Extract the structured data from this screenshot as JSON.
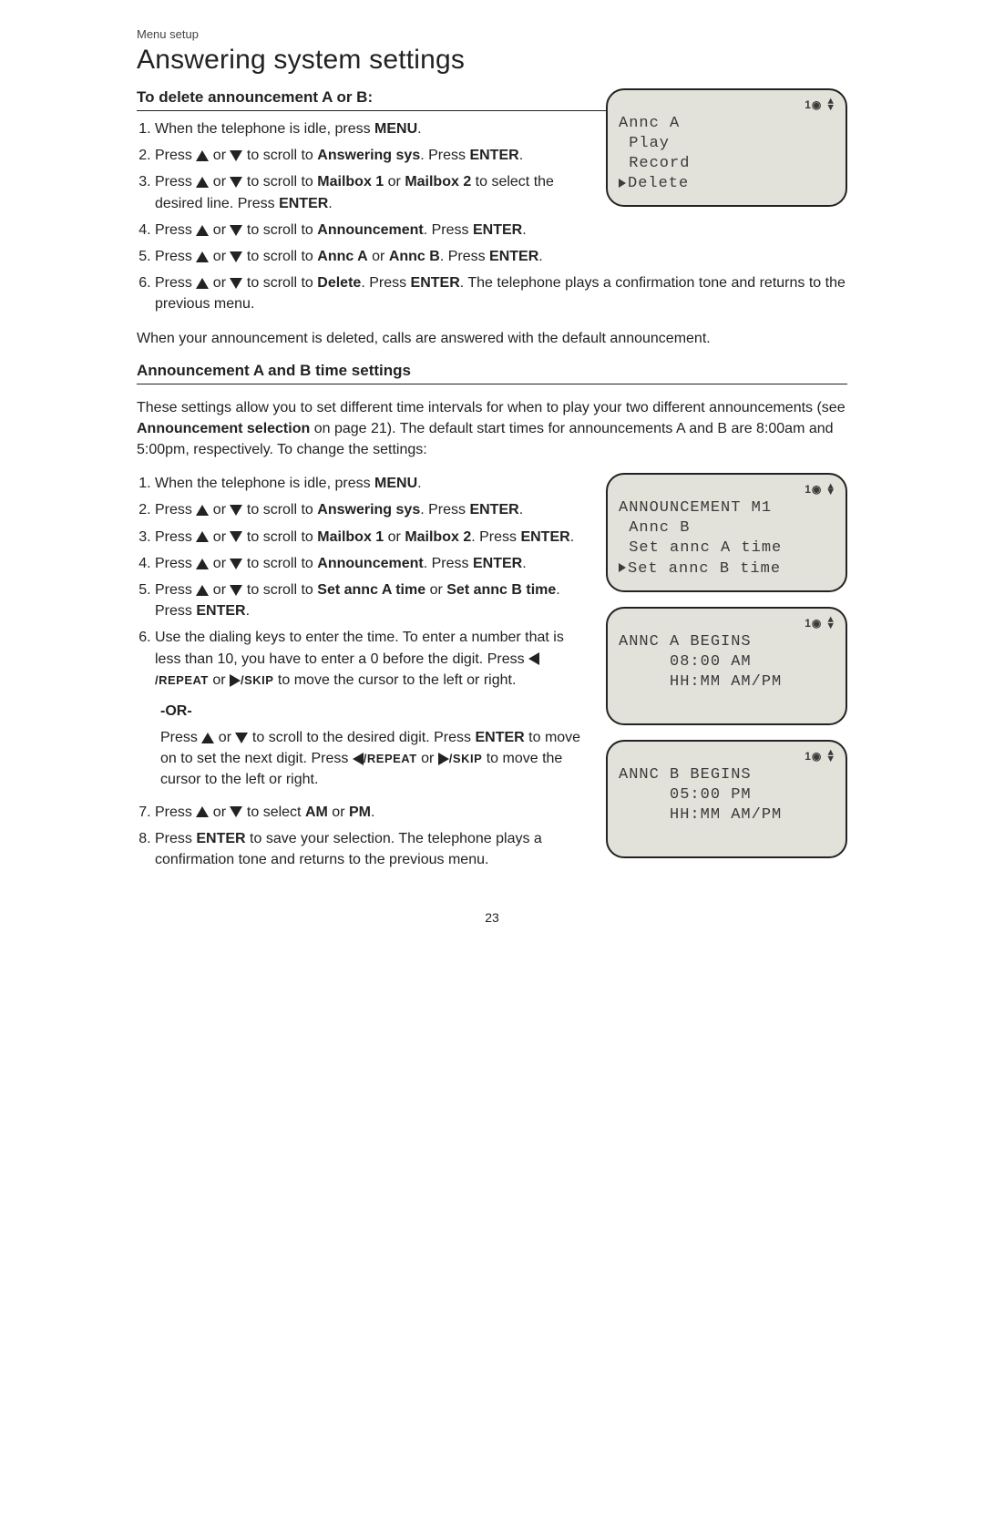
{
  "header": {
    "section_label": "Menu setup",
    "title": "Answering system settings"
  },
  "delete_section": {
    "heading": "To delete announcement A or B:",
    "steps": [
      {
        "pre": "When the telephone is idle, press ",
        "b1": "MENU",
        "post": "."
      },
      {
        "pre": "Press ",
        "mid1": " or ",
        "mid2": " to scroll to ",
        "b1": "Answering sys",
        "post1": ". Press ",
        "b2": "ENTER",
        "post2": "."
      },
      {
        "pre": "Press ",
        "mid1": " or ",
        "mid2": " to scroll to ",
        "b1": "Mailbox 1",
        "join": " or ",
        "b2": "Mailbox 2",
        "post1": " to select the desired line. Press ",
        "b3": "ENTER",
        "post2": "."
      },
      {
        "pre": "Press ",
        "mid1": " or ",
        "mid2": " to scroll to ",
        "b1": "Announcement",
        "post1": ". Press ",
        "b2": "ENTER",
        "post2": "."
      },
      {
        "pre": "Press ",
        "mid1": " or ",
        "mid2": " to scroll to ",
        "b1": "Annc A",
        "join": " or ",
        "b2": "Annc B",
        "post1": ". Press ",
        "b3": "ENTER",
        "post2": "."
      },
      {
        "pre": "Press ",
        "mid1": " or ",
        "mid2": " to scroll to ",
        "b1": "Delete",
        "post1": ". Press ",
        "b2": "ENTER",
        "post2": ". The telephone plays a confirmation tone and returns to the previous menu."
      }
    ],
    "after_text": "When your announcement is deleted, calls are answered with the default announcement."
  },
  "timeset_section": {
    "heading": "Announcement A and B time settings",
    "intro_pre": "These settings allow you to set different time intervals for when to play your two different announcements (see ",
    "intro_bold": "Announcement selection",
    "intro_post": " on page 21). The default start times for announcements A and B are 8:00am and 5:00pm, respectively. To change the settings:",
    "steps": [
      {
        "pre": "When the telephone is idle, press ",
        "b1": "MENU",
        "post": "."
      },
      {
        "pre": "Press ",
        "mid1": " or ",
        "mid2": " to scroll to ",
        "b1": "Answering sys",
        "post1": ". Press ",
        "b2": "ENTER",
        "post2": "."
      },
      {
        "pre": "Press ",
        "mid1": " or ",
        "mid2": " to scroll to ",
        "b1": "Mailbox 1",
        "join": " or ",
        "b2": "Mailbox 2",
        "post1": ". Press ",
        "b3": "ENTER",
        "post2": "."
      },
      {
        "pre": "Press ",
        "mid1": " or ",
        "mid2": " to scroll to ",
        "b1": "Announcement",
        "post1": ". Press ",
        "b2": "ENTER",
        "post2": "."
      },
      {
        "pre": "Press ",
        "mid1": " or ",
        "mid2": " to scroll to ",
        "b1": "Set annc A time",
        "join": " or ",
        "b2": "Set annc B time",
        "post1": ". Press ",
        "b3": "ENTER",
        "post2": "."
      },
      {
        "pre": "Use the dialing keys to enter the time. To enter a number that is less than 10, you have to enter a 0 before the digit. Press ",
        "key1": "/REPEAT",
        "mid1": " or ",
        "key2": "/SKIP",
        "post": " to move the cursor to the left or right."
      }
    ],
    "or_label": "-OR-",
    "or_step_pre": "Press ",
    "or_step_mid1": " or ",
    "or_step_mid2": " to scroll to the desired digit. Press ",
    "or_step_b1": "ENTER",
    "or_step_mid3": " to move on to set the next digit. Press ",
    "or_step_key1": "/REPEAT",
    "or_step_mid4": " or ",
    "or_step_key2": "/SKIP",
    "or_step_post": " to move the cursor to the left or right.",
    "step7_pre": "Press ",
    "step7_mid1": " or ",
    "step7_mid2": " to select ",
    "step7_b1": "AM",
    "step7_join": " or ",
    "step7_b2": "PM",
    "step7_post": ".",
    "step8_pre": "Press ",
    "step8_b1": "ENTER",
    "step8_post": " to save your selection. The telephone plays a confirmation tone and returns to the previous menu."
  },
  "lcd1": {
    "tape": "1",
    "l1": "Annc A",
    "l2": " Play",
    "l3": " Record",
    "l4_sel": "Delete"
  },
  "lcd2": {
    "tape": "1",
    "l1": "ANNOUNCEMENT M1",
    "l2": " Annc B",
    "l3": " Set annc A time",
    "l4_sel": "Set annc B time"
  },
  "lcd3": {
    "tape": "1",
    "l1": "ANNC A BEGINS",
    "l2": "     08:00 AM",
    "l3": "     HH:MM AM/PM"
  },
  "lcd4": {
    "tape": "1",
    "l1": "ANNC B BEGINS",
    "l2": "     05:00 PM",
    "l3": "     HH:MM AM/PM"
  },
  "footer": {
    "page_number": "23"
  }
}
